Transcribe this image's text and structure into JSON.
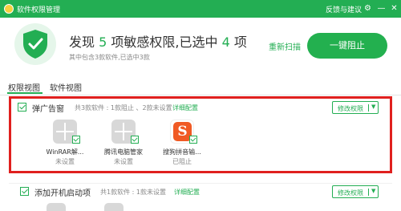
{
  "titlebar": {
    "title": "软件权限管理",
    "feedback": "反馈与建议",
    "settings_glyph": "⚙",
    "minimize_glyph": "—",
    "close_glyph": "✕"
  },
  "summary": {
    "prefix": "发现",
    "sensitive_count": "5",
    "middle": "项敏感权限,已选中",
    "selected_count": "4",
    "suffix": "项",
    "sub": "其中包含3款软件,已选中3款",
    "rescan": "重新扫描",
    "block_all": "一键阻止"
  },
  "tabs": [
    {
      "label": "权限视图",
      "active": true
    },
    {
      "label": "软件视图",
      "active": false
    }
  ],
  "groups": [
    {
      "title": "弹广告窗",
      "stat": "共3款软件 : 1款阻止 、2款未设置",
      "link": "详细配置",
      "modify": "修改权限",
      "caret": "▼",
      "apps": [
        {
          "name": "WinRAR解...",
          "status": "未设置",
          "icon": "grey-app-icon"
        },
        {
          "name": "腾讯电脑管家",
          "status": "未设置",
          "icon": "grey-app-icon"
        },
        {
          "name": "搜狗拼音输...",
          "status": "已阻止",
          "icon": "sogou-icon",
          "icon_letter": "S"
        }
      ]
    },
    {
      "title": "添加开机启动项",
      "stat": "共1款软件 : 1款未设置",
      "link": "详细配置",
      "modify": "修改权限",
      "caret": "▼"
    }
  ],
  "colors": {
    "brand_green": "#23ae53",
    "highlight_red": "#e0201e",
    "sogou_orange": "#f05a24"
  }
}
